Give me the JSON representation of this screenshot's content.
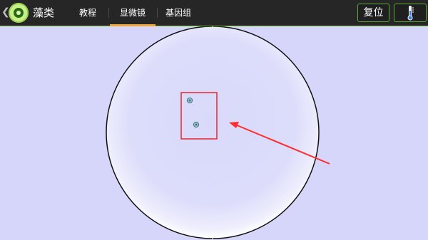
{
  "header": {
    "back_icon": "chevron-left-icon",
    "app_title": "藻类",
    "tabs": [
      {
        "label": "教程",
        "active": false
      },
      {
        "label": "显微镜",
        "active": true
      },
      {
        "label": "基因组",
        "active": false
      }
    ],
    "reset_label": "复位",
    "thermometer_icon": "thermometer-icon"
  },
  "colors": {
    "accent_green": "#6fbf3a",
    "active_tab_underline": "#f3a53a",
    "field_background": "#d6d6fb",
    "highlight_box": "#e8262a",
    "arrow": "#ff2d2d"
  },
  "microscope": {
    "highlighted_cells": 2
  }
}
